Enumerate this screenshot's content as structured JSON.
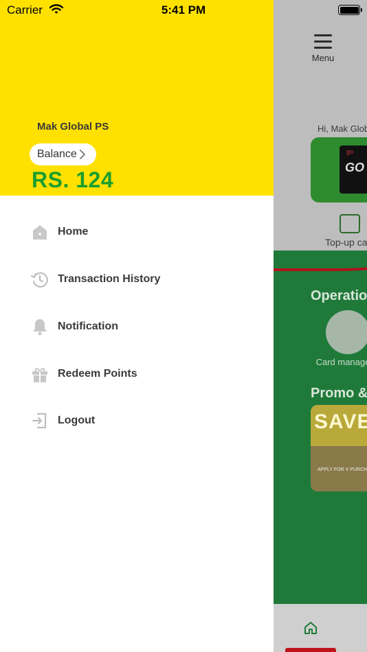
{
  "status_bar": {
    "carrier": "Carrier",
    "time": "5:41 PM"
  },
  "drawer": {
    "user_name": "Mak Global PS",
    "balance_label": "Balance",
    "balance_amount": "RS. 124",
    "header_color": "#ffe100",
    "amount_color": "#1a9e2e",
    "items": [
      {
        "label": "Home",
        "icon": "home-icon"
      },
      {
        "label": "Transaction History",
        "icon": "history-icon"
      },
      {
        "label": "Notification",
        "icon": "bell-icon"
      },
      {
        "label": "Redeem Points",
        "icon": "gift-icon"
      },
      {
        "label": "Logout",
        "icon": "logout-icon"
      }
    ]
  },
  "background": {
    "menu_label": "Menu",
    "greeting": "Hi, Mak Glob",
    "card_brand": "GO",
    "card_tag": "go",
    "topup_label": "Top-up card",
    "operations_title": "Operatio",
    "card_management_label": "Card manageme",
    "promo_title": "Promo &",
    "promo_banner_text": "SAVE",
    "promo_banner_small": "APPLY FOR V PURCHASE PETR",
    "accent_green": "#1f7a3a",
    "accent_red": "#c0141c"
  }
}
